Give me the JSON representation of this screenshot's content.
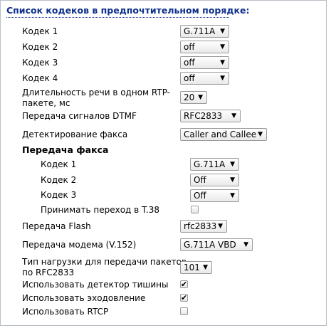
{
  "header": {
    "title": "Список кодеков в предпочтительном порядке:"
  },
  "codecs": {
    "codec1": {
      "label": "Кодек 1",
      "value": "G.711A"
    },
    "codec2": {
      "label": "Кодек 2",
      "value": "off"
    },
    "codec3": {
      "label": "Кодек 3",
      "value": "off"
    },
    "codec4": {
      "label": "Кодек 4",
      "value": "off"
    }
  },
  "rtp": {
    "label_line1": "Длительность речи в одном RTP-",
    "label_line2": "пакете, мс",
    "value": "20"
  },
  "dtmf": {
    "label": "Передача сигналов DTMF",
    "value": "RFC2833"
  },
  "fax_detect": {
    "label": "Детектирование факса",
    "value": "Caller and Callee"
  },
  "fax": {
    "title": "Передача факса",
    "codec1": {
      "label": "Кодек 1",
      "value": "G.711A"
    },
    "codec2": {
      "label": "Кодек 2",
      "value": "Off"
    },
    "codec3": {
      "label": "Кодек 3",
      "value": "Off"
    },
    "t38": {
      "label": "Принимать переход в T.38",
      "checked": false
    }
  },
  "flash": {
    "label": "Передача Flash",
    "value": "rfc2833"
  },
  "modem": {
    "label": "Передача модема (V.152)",
    "value": "G.711A VBD"
  },
  "payload": {
    "label_line1": "Тип нагрузки для передачи пакетов",
    "label_line2": "по RFC2833",
    "value": "101"
  },
  "silence": {
    "label": "Использовать детектор тишины",
    "checked": true
  },
  "echo": {
    "label": "Использовать эходовление",
    "checked": true
  },
  "rtcp": {
    "label": "Использовать RTCP",
    "checked": false
  },
  "icons": {
    "dropdown": "dropdown-arrow-icon",
    "check": "checkmark-icon"
  },
  "colors": {
    "header": "#0d2f8c",
    "border": "#b9bec6"
  }
}
